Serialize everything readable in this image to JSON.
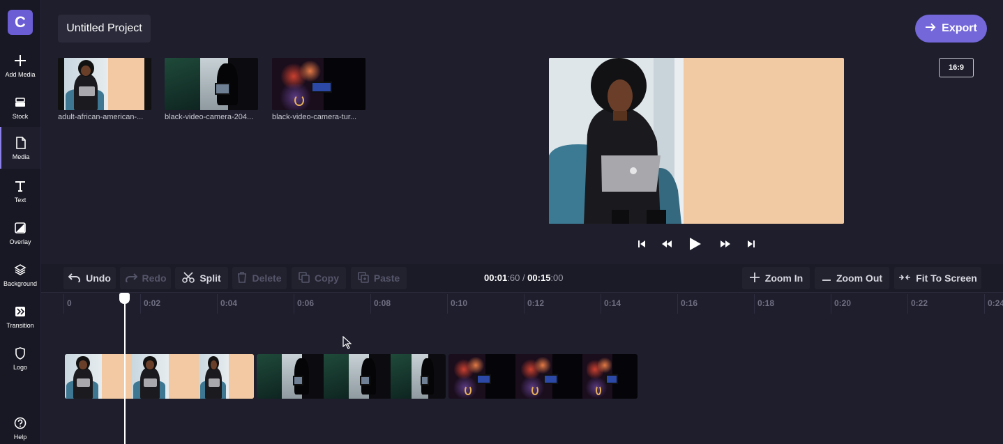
{
  "app": {
    "logo_letter": "C",
    "accent": "#7367d9"
  },
  "header": {
    "project_title": "Untitled Project",
    "export_label": "Export",
    "aspect_ratio": "16:9"
  },
  "sidebar": {
    "items": [
      {
        "label": "Add Media",
        "icon": "plus-icon"
      },
      {
        "label": "Stock",
        "icon": "stock-icon"
      },
      {
        "label": "Media",
        "icon": "file-icon",
        "active": true
      },
      {
        "label": "Text",
        "icon": "text-icon"
      },
      {
        "label": "Overlay",
        "icon": "overlay-icon"
      },
      {
        "label": "Background",
        "icon": "layers-icon"
      },
      {
        "label": "Transition",
        "icon": "transition-icon"
      },
      {
        "label": "Logo",
        "icon": "shield-icon"
      },
      {
        "label": "Help",
        "icon": "help-icon"
      }
    ]
  },
  "media": {
    "items": [
      {
        "name": "adult-african-american-..."
      },
      {
        "name": "black-video-camera-204..."
      },
      {
        "name": "black-video-camera-tur..."
      }
    ]
  },
  "toolbar": {
    "undo": "Undo",
    "redo": "Redo",
    "split": "Split",
    "delete": "Delete",
    "copy": "Copy",
    "paste": "Paste",
    "zoom_in": "Zoom In",
    "zoom_out": "Zoom Out",
    "fit": "Fit To Screen"
  },
  "time": {
    "current_main": "00:01",
    "current_frac": ":60",
    "separator": " / ",
    "total_main": "00:15",
    "total_frac": ":00"
  },
  "ruler": {
    "labels": [
      "0",
      "0:02",
      "0:04",
      "0:06",
      "0:08",
      "0:10",
      "0:12",
      "0:14",
      "0:16",
      "0:18",
      "0:20",
      "0:22",
      "0:24"
    ]
  }
}
